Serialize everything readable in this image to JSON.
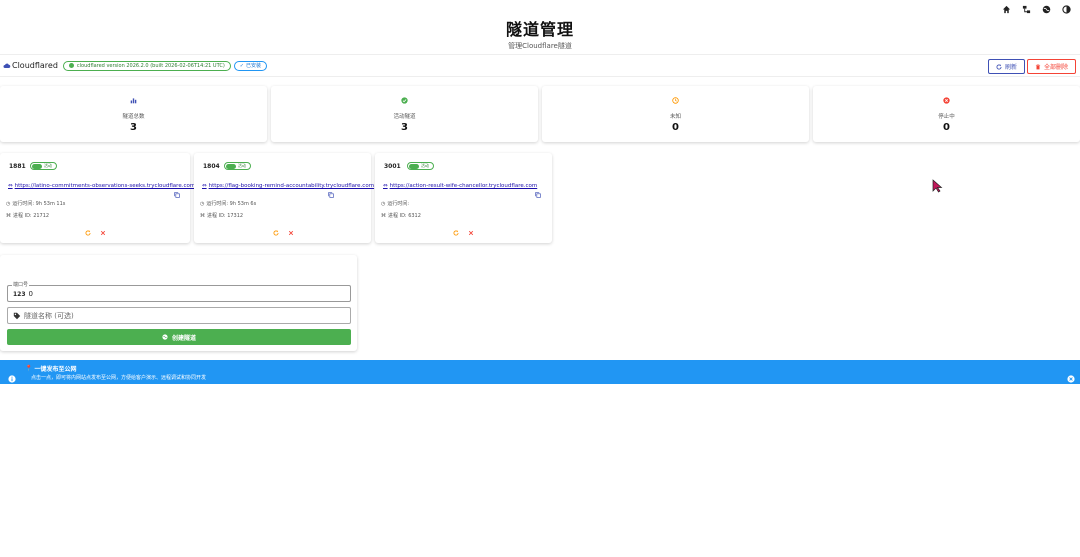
{
  "header": {
    "title": "隧道管理",
    "subtitle": "管理Cloudflare隧道"
  },
  "top_icons": [
    "home-icon",
    "sitemap-icon",
    "globe-icon",
    "dark-mode-icon"
  ],
  "statusbar": {
    "app_name": "Cloudflared",
    "version_chip": "cloudflared version 2026.2.0 (built 2026-02-06T14:21 UTC)",
    "installed_chip": "已安装",
    "refresh_label": "刷新",
    "delete_all_label": "全部删除"
  },
  "stats": [
    {
      "label": "隧道总数",
      "value": "3",
      "icon": "bar-chart-icon",
      "color": "#3f51b5"
    },
    {
      "label": "活动隧道",
      "value": "3",
      "icon": "check-circle-icon",
      "color": "#4caf50"
    },
    {
      "label": "未知",
      "value": "0",
      "icon": "clock-icon",
      "color": "#ff9800"
    },
    {
      "label": "停止中",
      "value": "0",
      "icon": "stop-circle-icon",
      "color": "#f44336"
    }
  ],
  "tunnels": [
    {
      "port": "1881",
      "status": "活动",
      "url": "https://latino-commitments-observations-seeks.trycloudflare.com",
      "uptime": "运行时间: 9h 53m 11s",
      "pid": "进程 ID: 21712"
    },
    {
      "port": "1804",
      "status": "活动",
      "url": "https://flag-booking-remind-accountability.trycloudflare.com",
      "uptime": "运行时间: 9h 53m 6s",
      "pid": "进程 ID: 17312"
    },
    {
      "port": "3001",
      "status": "活动",
      "url": "https://action-result-wife-chancellor.trycloudflare.com",
      "uptime": "运行时间:",
      "pid": "进程 ID: 6312"
    }
  ],
  "create": {
    "port_label": "端口号",
    "port_icon_text": "123",
    "port_value": "0",
    "name_placeholder": "隧道名称 (可选)",
    "create_button": "创建隧道"
  },
  "banner": {
    "title": "一键发布至公网",
    "desc": "点击一点，即可将内网站点发布至公网，方便给客户演示、远程调试和协同开发",
    "color": "#2196f3"
  }
}
